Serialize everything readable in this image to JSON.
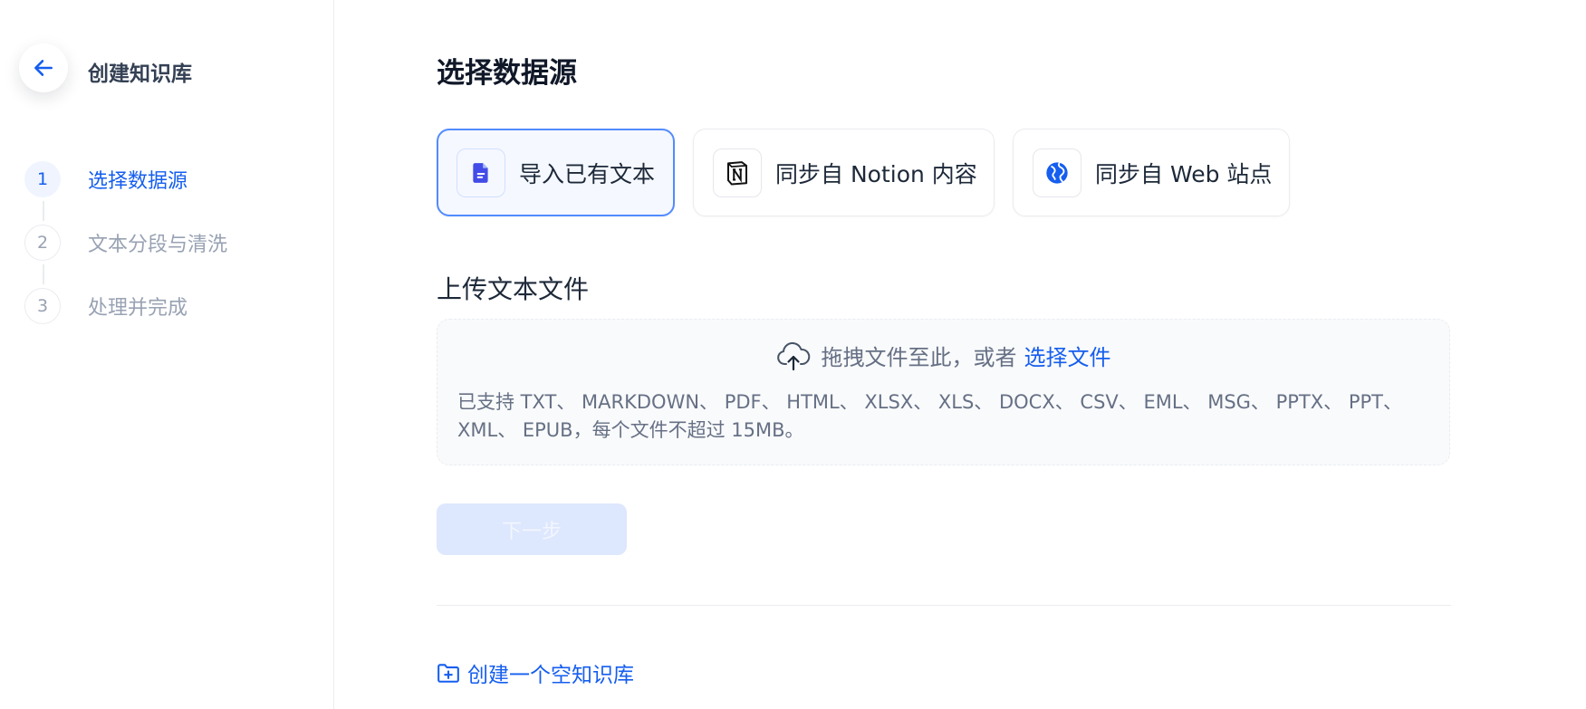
{
  "sidebar": {
    "title": "创建知识库",
    "steps": [
      {
        "number": "1",
        "label": "选择数据源",
        "state": "active"
      },
      {
        "number": "2",
        "label": "文本分段与清洗",
        "state": "inactive"
      },
      {
        "number": "3",
        "label": "处理并完成",
        "state": "inactive"
      }
    ]
  },
  "main": {
    "title": "选择数据源",
    "sources": [
      {
        "label": "导入已有文本",
        "icon": "document-icon",
        "selected": true
      },
      {
        "label": "同步自 Notion 内容",
        "icon": "notion-icon",
        "selected": false
      },
      {
        "label": "同步自 Web 站点",
        "icon": "web-globe-icon",
        "selected": false
      }
    ],
    "upload": {
      "section_title": "上传文本文件",
      "drop_text": "拖拽文件至此，或者",
      "select_link": "选择文件",
      "support_text": "已支持 TXT、 MARKDOWN、 PDF、 HTML、 XLSX、 XLS、 DOCX、 CSV、 EML、 MSG、 PPTX、 PPT、 XML、 EPUB，每个文件不超过 15MB。"
    },
    "next_button": "下一步",
    "create_empty": "创建一个空知识库"
  },
  "colors": {
    "accent": "#155eef",
    "selected_border": "#528bff",
    "disabled_button_bg": "#dde7fd",
    "muted_text": "#98a2b3"
  }
}
